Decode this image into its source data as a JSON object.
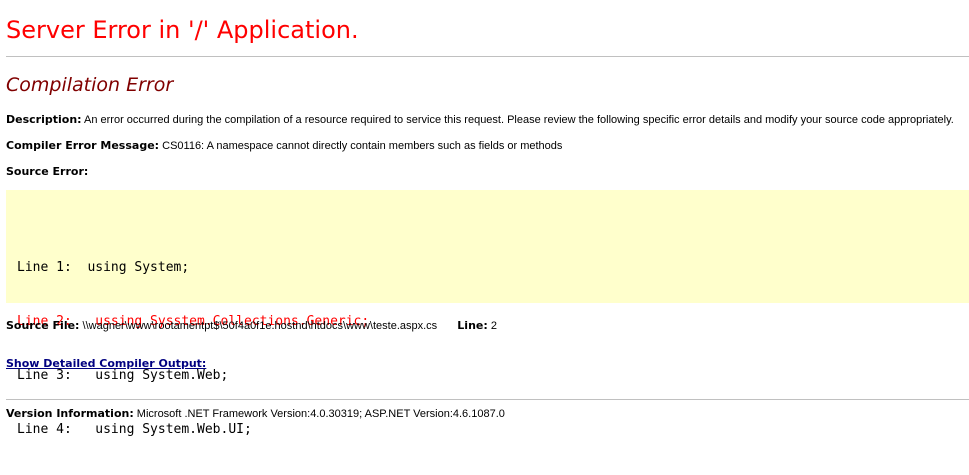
{
  "page": {
    "title": "Server Error in '/' Application.",
    "subtitle": "Compilation Error"
  },
  "description": {
    "label": "Description:",
    "text": "An error occurred during the compilation of a resource required to service this request. Please review the following specific error details and modify your source code appropriately."
  },
  "compiler_error": {
    "label": "Compiler Error Message:",
    "text": "CS0116: A namespace cannot directly contain members such as fields or methods"
  },
  "source_error": {
    "label": "Source Error:",
    "lines": [
      {
        "text": "Line 1:  using System;",
        "is_error": false
      },
      {
        "text": "Line 2:   ussing Sysstem.Collections.Generic;",
        "is_error": true
      },
      {
        "text": "Line 3:   using System.Web;",
        "is_error": false
      },
      {
        "text": "Line 4:   using System.Web.UI;",
        "is_error": false
      }
    ]
  },
  "source_file": {
    "label": "Source File:",
    "path": "\\\\wagner\\www\\rootamentpt$\\50f4a0f1e.hostnd\\htdocs\\www\\teste.aspx.cs",
    "line_label": "Line:",
    "line_value": "2"
  },
  "details_link": "Show Detailed Compiler Output:",
  "version": {
    "label": "Version Information:",
    "text": "Microsoft .NET Framework Version:4.0.30319; ASP.NET Version:4.6.1087.0"
  },
  "colors": {
    "title": "#ff0000",
    "subtitle": "#800000",
    "code_bg": "#ffffcc",
    "error_line": "#ff0000",
    "link": "#000080"
  }
}
